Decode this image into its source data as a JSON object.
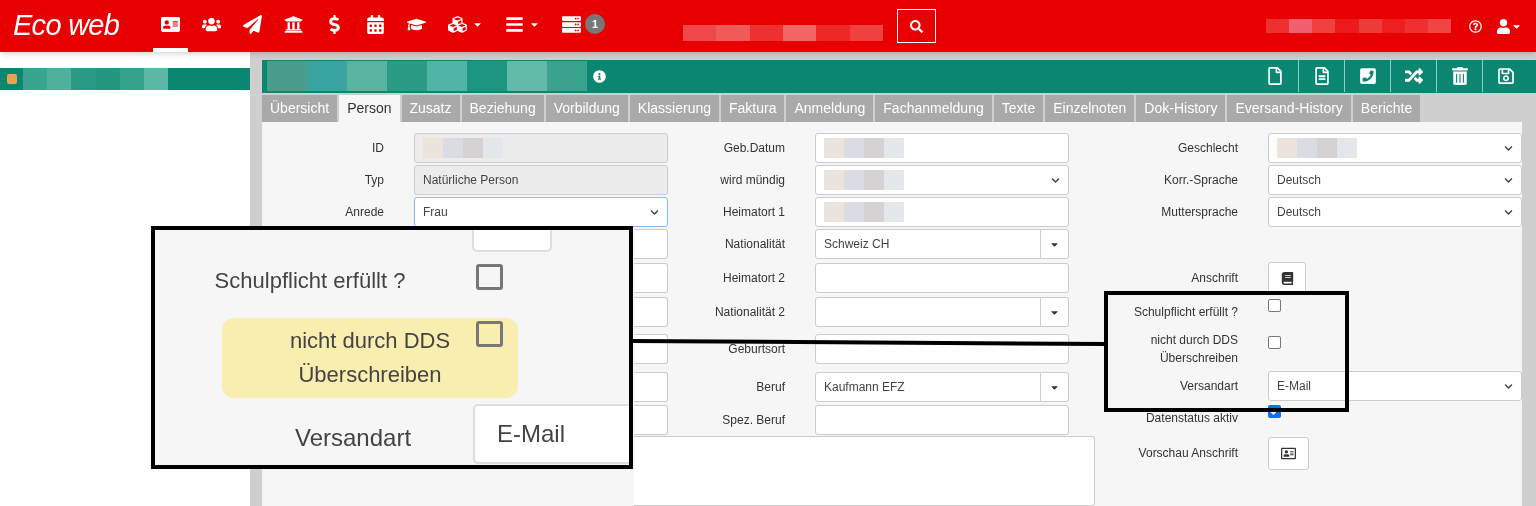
{
  "logo": "Eco web",
  "nav": [
    {
      "kind": "card",
      "selected": true
    },
    {
      "kind": "users",
      "selected": false
    },
    {
      "kind": "plane",
      "selected": false
    },
    {
      "kind": "bank",
      "selected": false
    },
    {
      "kind": "dollar",
      "selected": false
    },
    {
      "kind": "calendar",
      "selected": false
    },
    {
      "kind": "cap",
      "selected": false
    },
    {
      "kind": "cubes",
      "selected": false,
      "caret": true
    },
    {
      "kind": "bars",
      "selected": false,
      "caret": true
    },
    {
      "kind": "list",
      "selected": false,
      "badge": "1"
    }
  ],
  "tabs": [
    {
      "label": "Übersicht",
      "selected": false
    },
    {
      "label": "Person",
      "selected": true
    },
    {
      "label": "Zusatz",
      "selected": false
    },
    {
      "label": "Beziehung",
      "selected": false
    },
    {
      "label": "Vorbildung",
      "selected": false
    },
    {
      "label": "Klassierung",
      "selected": false
    },
    {
      "label": "Faktura",
      "selected": false
    },
    {
      "label": "Anmeldung",
      "selected": false
    },
    {
      "label": "Fachanmeldung",
      "selected": false
    },
    {
      "label": "Texte",
      "selected": false
    },
    {
      "label": "Einzelnoten",
      "selected": false
    },
    {
      "label": "Dok-History",
      "selected": false
    },
    {
      "label": "Eversand-History",
      "selected": false
    },
    {
      "label": "Berichte",
      "selected": false
    }
  ],
  "form": {
    "column_1": [
      {
        "label": "ID",
        "kind": "text",
        "masked": true,
        "readonly": true
      },
      {
        "label": "Typ",
        "kind": "text",
        "value": "Natürliche Person",
        "readonly": true
      },
      {
        "label": "Anrede",
        "kind": "select",
        "value": "Frau",
        "focused": true
      },
      {
        "kind": "text"
      },
      {
        "kind": "text"
      },
      {
        "kind": "text"
      },
      {
        "kind": "text"
      },
      {
        "kind": "text"
      },
      {
        "kind": "text"
      }
    ],
    "column_2": [
      {
        "label": "Geb.Datum",
        "kind": "text",
        "masked": true
      },
      {
        "label": "wird mündig",
        "kind": "select",
        "masked": true
      },
      {
        "label": "Heimatort 1",
        "kind": "text",
        "masked": true
      },
      {
        "label": "Nationalität",
        "kind": "combo",
        "value": "Schweiz CH"
      },
      {
        "label": "Heimatort 2",
        "kind": "text"
      },
      {
        "label": "Nationalität 2",
        "kind": "combo"
      },
      {
        "label": "Geburtsort",
        "kind": "text"
      },
      {
        "label": "Beruf",
        "kind": "combo",
        "value": "Kaufmann EFZ"
      },
      {
        "label": "Spez. Beruf",
        "kind": "text"
      }
    ],
    "column_3": [
      {
        "label": "Geschlecht",
        "kind": "select",
        "masked": true
      },
      {
        "label": "Korr.-Sprache",
        "kind": "select",
        "value": "Deutsch"
      },
      {
        "label": "Muttersprache",
        "kind": "select",
        "value": "Deutsch"
      },
      {
        "kind": "spacer"
      },
      {
        "label": "Anschrift",
        "kind": "lookup"
      },
      {
        "label": "Schulpflicht erfüllt ?",
        "kind": "checkbox",
        "checked": false
      },
      {
        "label": "nicht durch DDS Überschreiben",
        "kind": "checkbox",
        "checked": false
      },
      {
        "label": "Versandart",
        "kind": "select",
        "value": "E-Mail"
      },
      {
        "label": "Datenstatus aktiv",
        "kind": "checkbox",
        "checked": true
      },
      {
        "label": "Vorschau Anschrift",
        "kind": "preview"
      }
    ]
  },
  "callout": {
    "rows": [
      {
        "kind": "field"
      },
      {
        "kind": "checkbox",
        "label": "Schulpflicht erfüllt ?",
        "checked": false,
        "highlighted": false
      },
      {
        "kind": "checkbox",
        "label": "nicht durch DDS Überschreiben",
        "checked": false,
        "highlighted": true
      },
      {
        "kind": "text",
        "label": "Versandart",
        "value": "E-Mail"
      }
    ]
  }
}
